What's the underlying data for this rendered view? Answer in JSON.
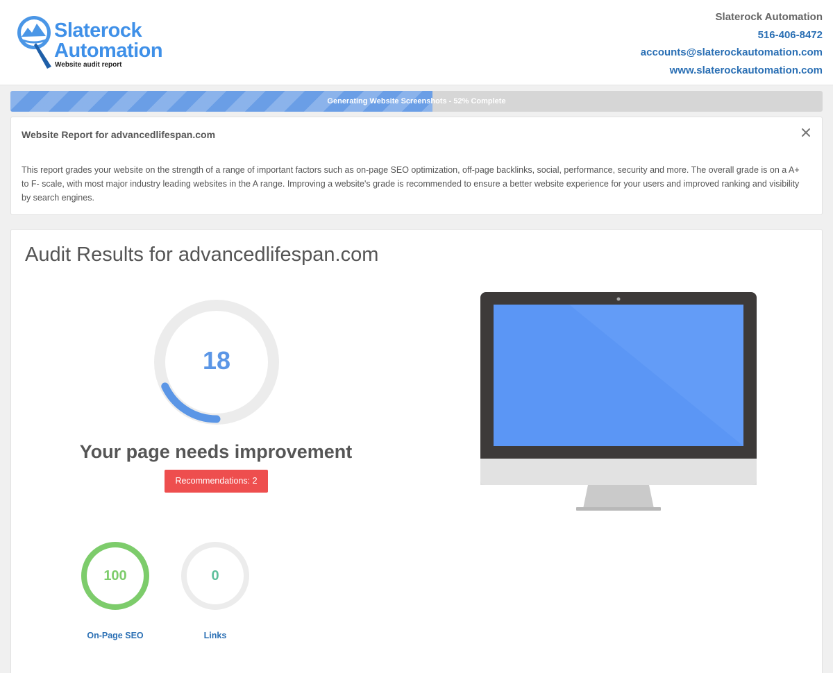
{
  "header": {
    "logo": {
      "line1": "Slaterock",
      "line2": "Automation",
      "tagline": "Website audit report"
    },
    "contact": {
      "company": "Slaterock Automation",
      "phone": "516-406-8472",
      "email": "accounts@slaterockautomation.com",
      "website": "www.slaterockautomation.com"
    }
  },
  "progress": {
    "label": "Generating Website Screenshots - 52% Complete",
    "fraction": 0.52
  },
  "info_panel": {
    "title": "Website Report for advancedlifespan.com",
    "body": "This report grades your website on the strength of a range of important factors such as on-page SEO optimization, off-page backlinks, social, performance, security and more. The overall grade is on a A+ to F- scale, with most major industry leading websites in the A range. Improving a website's grade is recommended to ensure a better website experience for your users and improved ranking and visibility by search engines."
  },
  "results": {
    "title": "Audit Results for advancedlifespan.com",
    "score": "18",
    "score_fraction": 0.18,
    "verdict": "Your page needs improvement",
    "recommendations_label": "Recommendations: 2",
    "metrics": [
      {
        "label": "On-Page SEO",
        "value": "100",
        "fraction": 1.0,
        "color": "#7dcc6b"
      },
      {
        "label": "Links",
        "value": "0",
        "fraction": 0.0,
        "color": "#5dbf9b"
      }
    ]
  },
  "colors": {
    "accent_blue": "#5b96e6",
    "danger_red": "#ee4e4e",
    "link_blue": "#2a6fb4",
    "ring_track": "#ececec",
    "screen_blue": "#5b96f5"
  },
  "icons": {
    "close": "close-icon",
    "logo": "magnifier-mountain-logo-icon",
    "monitor": "desktop-monitor-icon"
  }
}
